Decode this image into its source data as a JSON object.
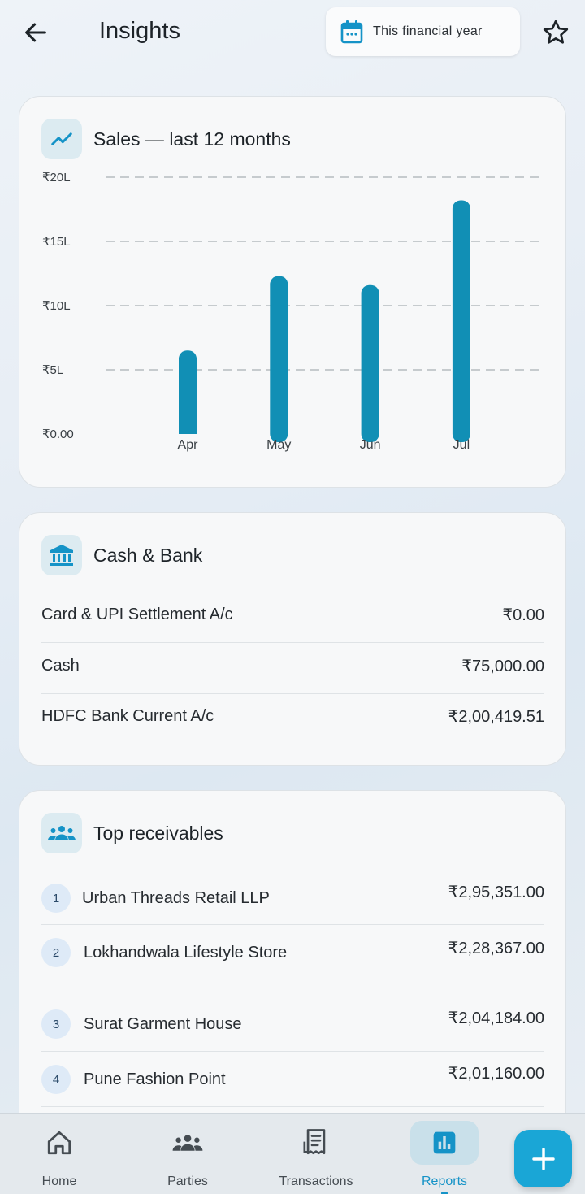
{
  "header": {
    "title": "Insights",
    "date_filter": "This financial year"
  },
  "sales_card": {
    "title": "Sales — last 12 months"
  },
  "chart_data": {
    "type": "bar",
    "categories": [
      "Apr",
      "May",
      "Jun",
      "Jul"
    ],
    "values": [
      6.5,
      12.3,
      11.6,
      18.2
    ],
    "ylim": [
      0,
      20
    ],
    "yticks": [
      0,
      5,
      10,
      15,
      20
    ],
    "ytick_labels": [
      "₹0.00",
      "₹5L",
      "₹10L",
      "₹15L",
      "₹20L"
    ],
    "grid": true,
    "bar_color": "#118fb5",
    "title": "",
    "xlabel": "",
    "ylabel": ""
  },
  "cash_bank": {
    "title": "Cash & Bank",
    "rows": [
      {
        "name": "Card & UPI Settlement A/c",
        "amount": "₹0.00"
      },
      {
        "name": "Cash",
        "amount": "₹75,000.00"
      },
      {
        "name": "HDFC Bank Current A/c",
        "amount": "₹2,00,419.51"
      }
    ]
  },
  "receivables": {
    "title": "Top receivables",
    "rows": [
      {
        "rank": "1",
        "name": "Urban Threads Retail LLP",
        "amount": "₹2,95,351.00"
      },
      {
        "rank": "2",
        "name": "Lokhandwala Lifestyle Store",
        "amount": "₹2,28,367.00"
      },
      {
        "rank": "3",
        "name": "Surat Garment House",
        "amount": "₹2,04,184.00"
      },
      {
        "rank": "4",
        "name": "Pune Fashion Point",
        "amount": "₹2,01,160.00"
      }
    ]
  },
  "nav": {
    "items": [
      {
        "label": "Home",
        "icon": "home-icon"
      },
      {
        "label": "Parties",
        "icon": "people-icon"
      },
      {
        "label": "Transactions",
        "icon": "receipt-icon"
      },
      {
        "label": "Reports",
        "icon": "bar-chart-icon",
        "active": true
      }
    ],
    "fab_icon": "plus-icon"
  },
  "colors": {
    "accent": "#1593c7",
    "bar": "#118fb5",
    "fab": "#1aa6d6"
  }
}
